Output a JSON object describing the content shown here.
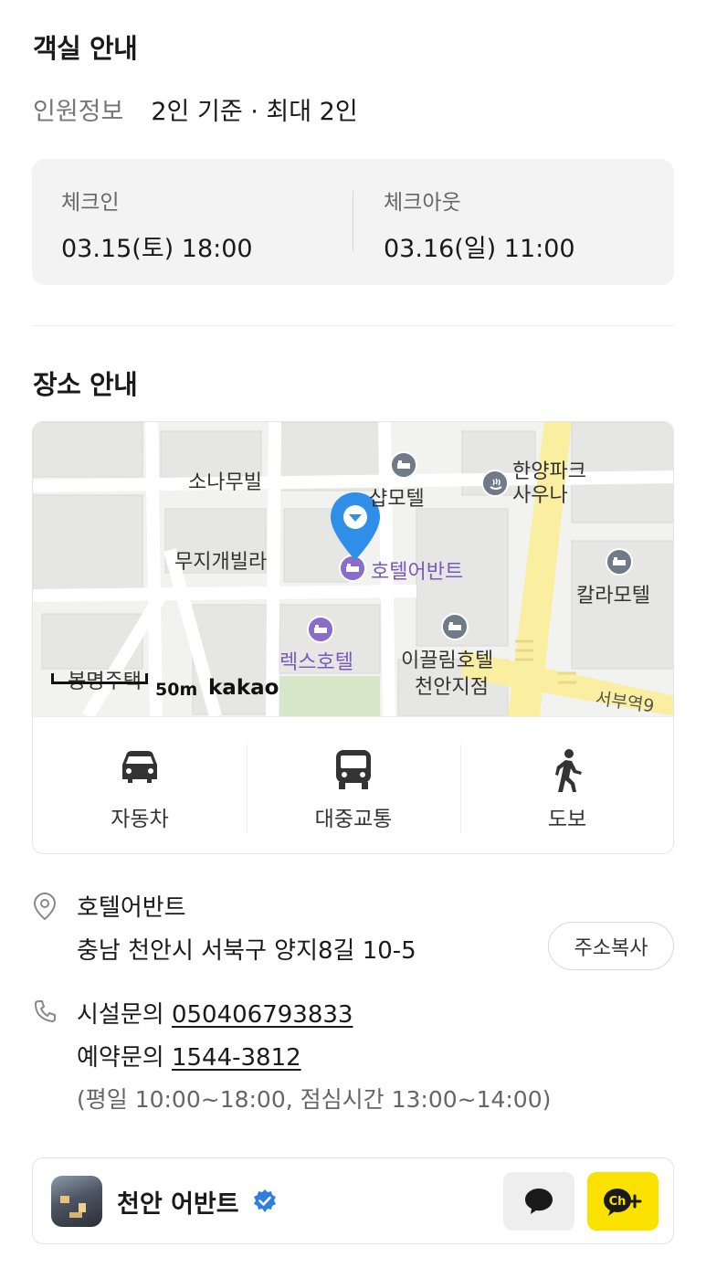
{
  "room": {
    "title": "객실 안내",
    "occupancy_label": "인원정보",
    "occupancy_value": "2인 기준 · 최대 2인",
    "checkin_label": "체크인",
    "checkin_value": "03.15(토) 18:00",
    "checkout_label": "체크아웃",
    "checkout_value": "03.16(일) 11:00"
  },
  "place": {
    "title": "장소 안내",
    "map": {
      "labels": {
        "sonamu": "소나무빌",
        "syap": "샵모텔",
        "hanyang": "한양파크\n사우나",
        "muji": "무지개빌라",
        "hotel": "호텔어반트",
        "kalla": "칼라모텔",
        "rex": "렉스호텔",
        "ikkeulim1": "이끌림호텔",
        "ikkeulim2": "천안지점",
        "bongmyeong": "봉명주택",
        "seobu": "서부역9"
      },
      "scale": "50m",
      "provider": "kakao"
    },
    "transport": [
      {
        "label": "자동차",
        "icon": "car-icon"
      },
      {
        "label": "대중교통",
        "icon": "bus-icon"
      },
      {
        "label": "도보",
        "icon": "walk-icon"
      }
    ],
    "address_name": "호텔어반트",
    "address": "충남 천안시 서북구 양지8길 10-5",
    "copy_label": "주소복사",
    "facility_label": "시설문의",
    "facility_phone": "050406793833",
    "reservation_label": "예약문의",
    "reservation_phone": "1544-3812",
    "hours": "(평일 10:00~18:00, 점심시간 13:00~14:00)"
  },
  "channel": {
    "name": "천안 어반트",
    "chat_icon": "chat-bubble-icon",
    "add_channel_icon": "kakao-channel-add-icon"
  },
  "colors": {
    "kakao_yellow": "#fae100",
    "verified_blue": "#2f7fe0",
    "pin_blue": "#2f8fe8",
    "hotel_purple": "#8a6cc9"
  }
}
